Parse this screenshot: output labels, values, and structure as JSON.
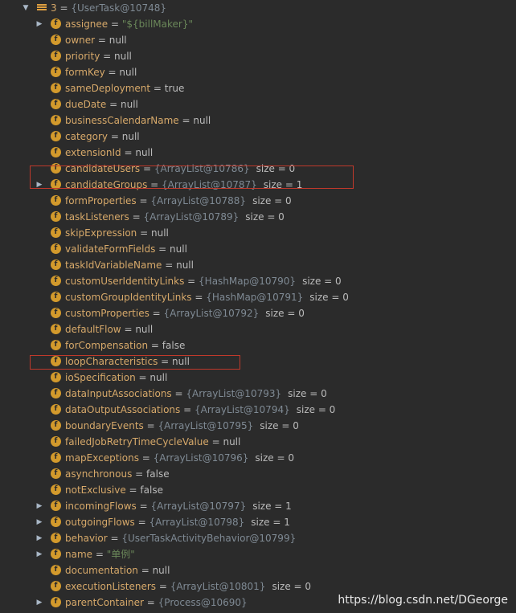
{
  "root": {
    "expand_glyph": "▼",
    "label": "3",
    "eq": " = ",
    "ref": "{UserTask@10748}"
  },
  "fields": [
    {
      "name": "assignee",
      "expander": true,
      "kind": "str",
      "value": "\"${billMaker}\""
    },
    {
      "name": "owner",
      "kind": "val",
      "value": "null"
    },
    {
      "name": "priority",
      "kind": "val",
      "value": "null"
    },
    {
      "name": "formKey",
      "kind": "val",
      "value": "null"
    },
    {
      "name": "sameDeployment",
      "kind": "val",
      "value": "true"
    },
    {
      "name": "dueDate",
      "kind": "val",
      "value": "null"
    },
    {
      "name": "businessCalendarName",
      "kind": "val",
      "value": "null"
    },
    {
      "name": "category",
      "kind": "val",
      "value": "null"
    },
    {
      "name": "extensionId",
      "kind": "val",
      "value": "null"
    },
    {
      "name": "candidateUsers",
      "kind": "ref",
      "value": "{ArrayList@10786}",
      "size": "size = 0"
    },
    {
      "name": "candidateGroups",
      "expander": true,
      "kind": "ref",
      "value": "{ArrayList@10787}",
      "size": "size = 1"
    },
    {
      "name": "formProperties",
      "kind": "ref",
      "value": "{ArrayList@10788}",
      "size": "size = 0"
    },
    {
      "name": "taskListeners",
      "kind": "ref",
      "value": "{ArrayList@10789}",
      "size": "size = 0"
    },
    {
      "name": "skipExpression",
      "kind": "val",
      "value": "null"
    },
    {
      "name": "validateFormFields",
      "kind": "val",
      "value": "null"
    },
    {
      "name": "taskIdVariableName",
      "kind": "val",
      "value": "null"
    },
    {
      "name": "customUserIdentityLinks",
      "kind": "ref",
      "value": "{HashMap@10790}",
      "size": "size = 0"
    },
    {
      "name": "customGroupIdentityLinks",
      "kind": "ref",
      "value": "{HashMap@10791}",
      "size": "size = 0"
    },
    {
      "name": "customProperties",
      "kind": "ref",
      "value": "{ArrayList@10792}",
      "size": "size = 0"
    },
    {
      "name": "defaultFlow",
      "kind": "val",
      "value": "null"
    },
    {
      "name": "forCompensation",
      "kind": "val",
      "value": "false"
    },
    {
      "name": "loopCharacteristics",
      "kind": "val",
      "value": "null"
    },
    {
      "name": "ioSpecification",
      "kind": "val",
      "value": "null"
    },
    {
      "name": "dataInputAssociations",
      "kind": "ref",
      "value": "{ArrayList@10793}",
      "size": "size = 0"
    },
    {
      "name": "dataOutputAssociations",
      "kind": "ref",
      "value": "{ArrayList@10794}",
      "size": "size = 0"
    },
    {
      "name": "boundaryEvents",
      "kind": "ref",
      "value": "{ArrayList@10795}",
      "size": "size = 0"
    },
    {
      "name": "failedJobRetryTimeCycleValue",
      "kind": "val",
      "value": "null"
    },
    {
      "name": "mapExceptions",
      "kind": "ref",
      "value": "{ArrayList@10796}",
      "size": "size = 0"
    },
    {
      "name": "asynchronous",
      "kind": "val",
      "value": "false"
    },
    {
      "name": "notExclusive",
      "kind": "val",
      "value": "false"
    },
    {
      "name": "incomingFlows",
      "expander": true,
      "kind": "ref",
      "value": "{ArrayList@10797}",
      "size": "size = 1"
    },
    {
      "name": "outgoingFlows",
      "expander": true,
      "kind": "ref",
      "value": "{ArrayList@10798}",
      "size": "size = 1"
    },
    {
      "name": "behavior",
      "expander": true,
      "kind": "ref",
      "value": "{UserTaskActivityBehavior@10799}"
    },
    {
      "name": "name",
      "expander": true,
      "kind": "str",
      "value": "\"单例\""
    },
    {
      "name": "documentation",
      "kind": "val",
      "value": "null"
    },
    {
      "name": "executionListeners",
      "kind": "ref",
      "value": "{ArrayList@10801}",
      "size": "size = 0"
    },
    {
      "name": "parentContainer",
      "expander": true,
      "kind": "ref",
      "value": "{Process@10690}"
    }
  ],
  "field_icon_glyph": "f",
  "collapsed_glyph": "▶",
  "equals": " = ",
  "highlight_color": "#c0392b",
  "watermark": "https://blog.csdn.net/DGeorge"
}
